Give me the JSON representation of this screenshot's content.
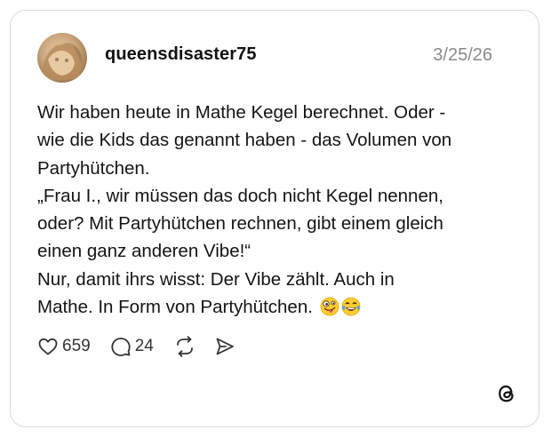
{
  "post": {
    "username": "queensdisaster75",
    "date": "3/25/26",
    "lines": [
      "Wir haben heute in Mathe Kegel berechnet. Oder -",
      "wie die Kids das genannt haben - das Volumen von",
      "Partyhütchen.",
      "„Frau I., wir müssen das doch nicht Kegel nennen,",
      "oder? Mit Partyhütchen rechnen, gibt einem gleich",
      "einen ganz anderen Vibe!“",
      "Nur, damit ihrs wisst: Der Vibe zählt. Auch in",
      "Mathe. In Form von Partyhütchen. "
    ],
    "emojis": [
      "zany-face-emoji",
      "tears-of-joy-emoji"
    ]
  },
  "actions": {
    "likes": "659",
    "comments": "24",
    "like_icon": "heart-icon",
    "comment_icon": "speech-bubble-icon",
    "repost_icon": "repost-icon",
    "share_icon": "send-icon"
  },
  "brand": {
    "logo": "threads-logo-icon"
  }
}
